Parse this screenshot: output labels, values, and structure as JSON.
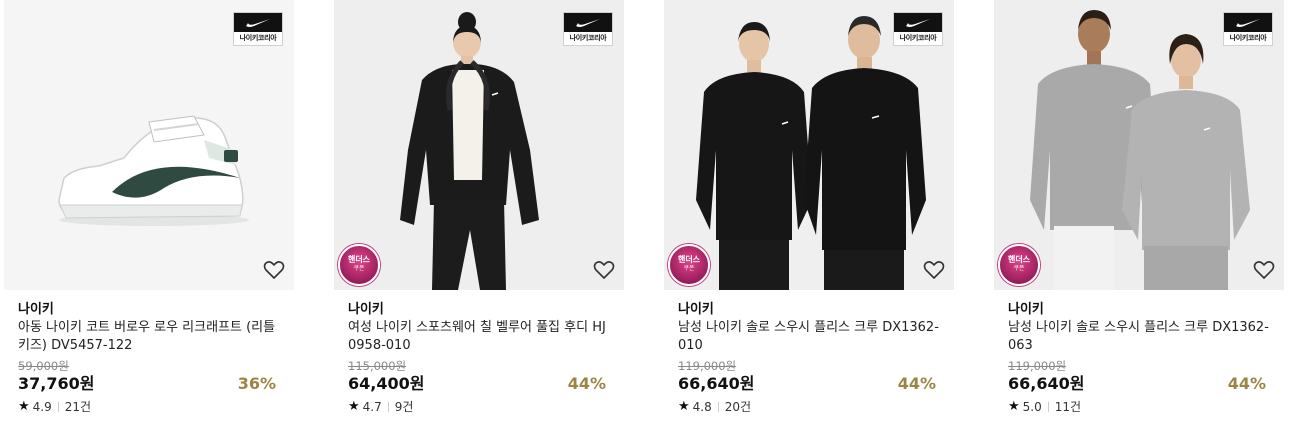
{
  "products": [
    {
      "brand": "나이키",
      "name": "아동 나이키 코트 버로우 로우 리크래프트 (리틀키즈) DV5457-122",
      "original_price": "59,000원",
      "price": "37,760원",
      "discount": "36%",
      "rating": "4.9",
      "reviews": "21건",
      "store_badge": "나이키코리아",
      "coupon": false
    },
    {
      "brand": "나이키",
      "name": "여성 나이키 스포츠웨어 칠 벨루어 풀집 후디 HJ0958-010",
      "original_price": "115,000원",
      "price": "64,400원",
      "discount": "44%",
      "rating": "4.7",
      "reviews": "9건",
      "store_badge": "나이키코리아",
      "coupon": true,
      "coupon_line1": "핸더스",
      "coupon_line2": "쿠폰"
    },
    {
      "brand": "나이키",
      "name": "남성 나이키 솔로 스우시 플리스 크루 DX1362-010",
      "original_price": "119,000원",
      "price": "66,640원",
      "discount": "44%",
      "rating": "4.8",
      "reviews": "20건",
      "store_badge": "나이키코리아",
      "coupon": true,
      "coupon_line1": "핸더스",
      "coupon_line2": "쿠폰"
    },
    {
      "brand": "나이키",
      "name": "남성 나이키 솔로 스우시 플리스 크루 DX1362-063",
      "original_price": "119,000원",
      "price": "66,640원",
      "discount": "44%",
      "rating": "5.0",
      "reviews": "11건",
      "store_badge": "나이키코리아",
      "coupon": true,
      "coupon_line1": "핸더스",
      "coupon_line2": "쿠폰"
    }
  ],
  "icons": {
    "heart": "heart-outline-icon",
    "star": "star-icon",
    "swoosh": "nike-swoosh-icon"
  },
  "colors": {
    "discount": "#9b8545",
    "coupon": "#c63a7a",
    "thumb_bg": "#f5f5f5"
  }
}
